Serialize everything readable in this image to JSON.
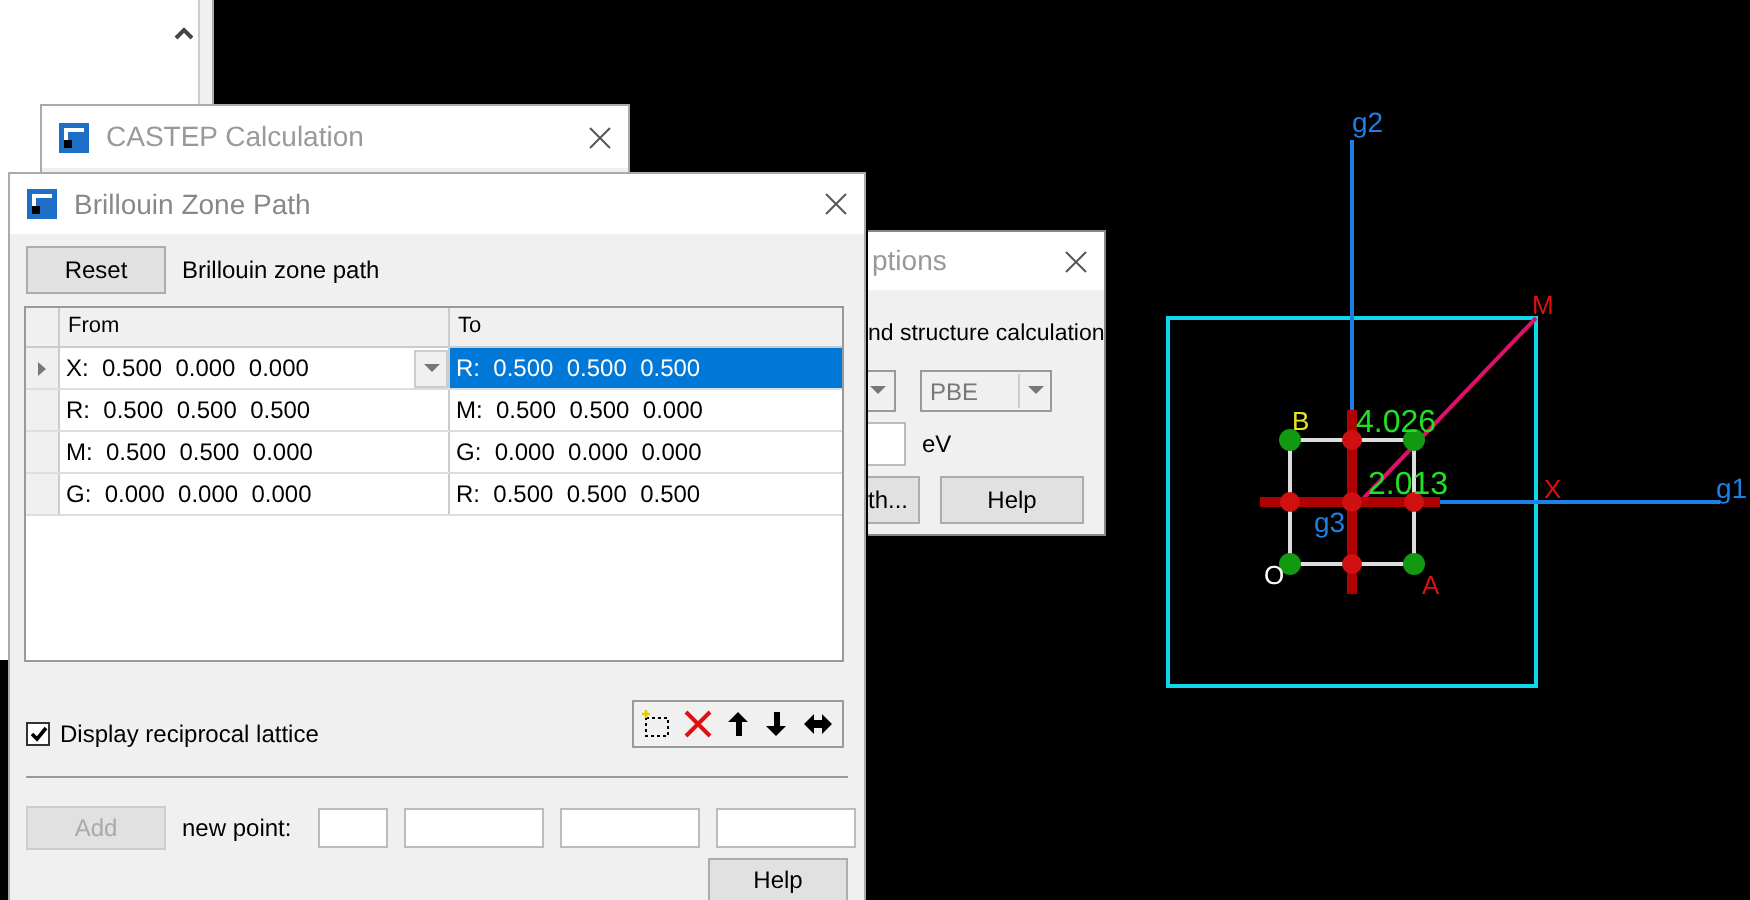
{
  "castep_window": {
    "title": "CASTEP Calculation"
  },
  "options_window": {
    "title": "ptions",
    "description": "nd structure calculation",
    "functional": "PBE",
    "unit": "eV",
    "buttons": [
      "th...",
      "Help"
    ]
  },
  "zone_path_window": {
    "title": "Brillouin Zone Path",
    "reset_button": "Reset",
    "path_label": "Brillouin zone path",
    "columns": [
      "From",
      "To"
    ],
    "rows": [
      {
        "from": "X:  0.500  0.000  0.000",
        "to": "R:  0.500  0.500  0.500",
        "selected": true
      },
      {
        "from": "R:  0.500  0.500  0.500",
        "to": "M:  0.500  0.500  0.000",
        "selected": false
      },
      {
        "from": "M:  0.500  0.500  0.000",
        "to": "G:  0.000  0.000  0.000",
        "selected": false
      },
      {
        "from": "G:  0.000  0.000  0.000",
        "to": "R:  0.500  0.500  0.500",
        "selected": false
      }
    ],
    "display_reciprocal_lattice": {
      "label": "Display reciprocal lattice",
      "checked": true
    },
    "add_button": {
      "label": "Add",
      "disabled": true
    },
    "new_point_label": "new point:",
    "help_button": "Help"
  },
  "viewer": {
    "axis_labels": [
      "g2",
      "g1",
      "g3"
    ],
    "point_labels": [
      "M",
      "B",
      "X",
      "O",
      "A"
    ],
    "distances": [
      "4.026",
      "2.013"
    ]
  }
}
